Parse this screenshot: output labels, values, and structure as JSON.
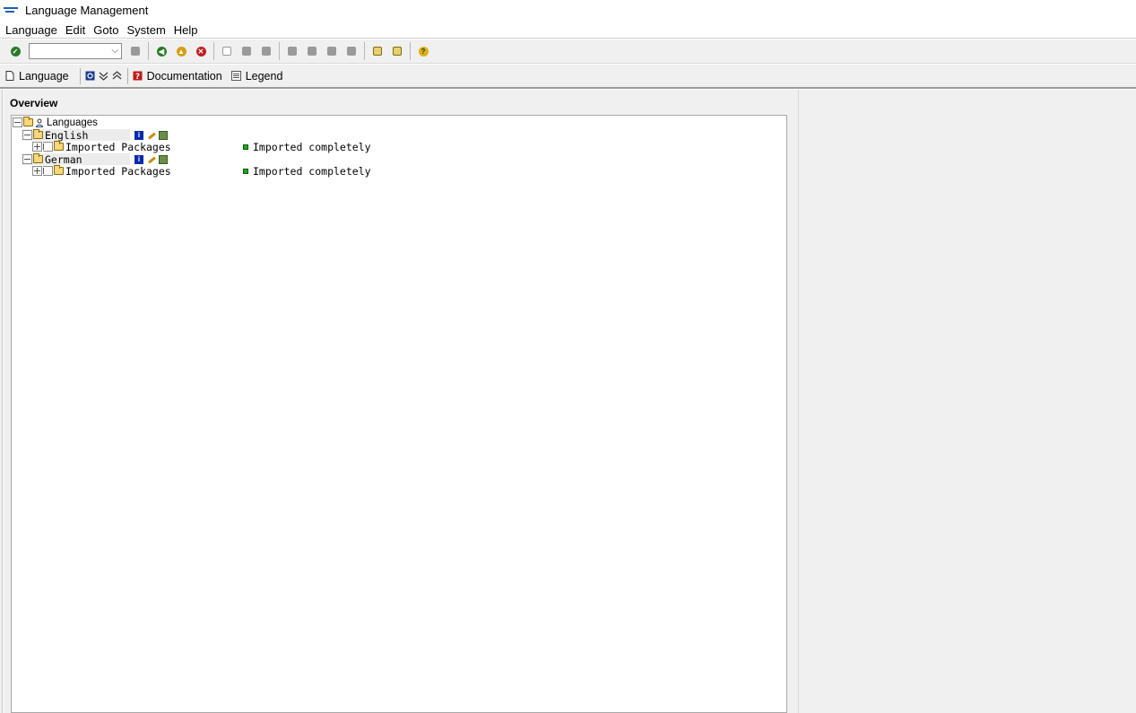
{
  "window": {
    "title": "Language Management"
  },
  "menu": [
    "Language",
    "Edit",
    "Goto",
    "System",
    "Help"
  ],
  "command_field": {
    "value": ""
  },
  "app_toolbar": {
    "language_label": "Language",
    "documentation_label": "Documentation",
    "legend_label": "Legend"
  },
  "overview": {
    "title": "Overview",
    "root_label": "Languages",
    "languages": [
      {
        "name": "English",
        "packages_label": "Imported Packages",
        "status": "Imported completely"
      },
      {
        "name": "German",
        "packages_label": "Imported Packages",
        "status": "Imported completely"
      }
    ]
  },
  "colors": {
    "status_ok": "#1fa81f",
    "brand": "#1a5fb4"
  }
}
